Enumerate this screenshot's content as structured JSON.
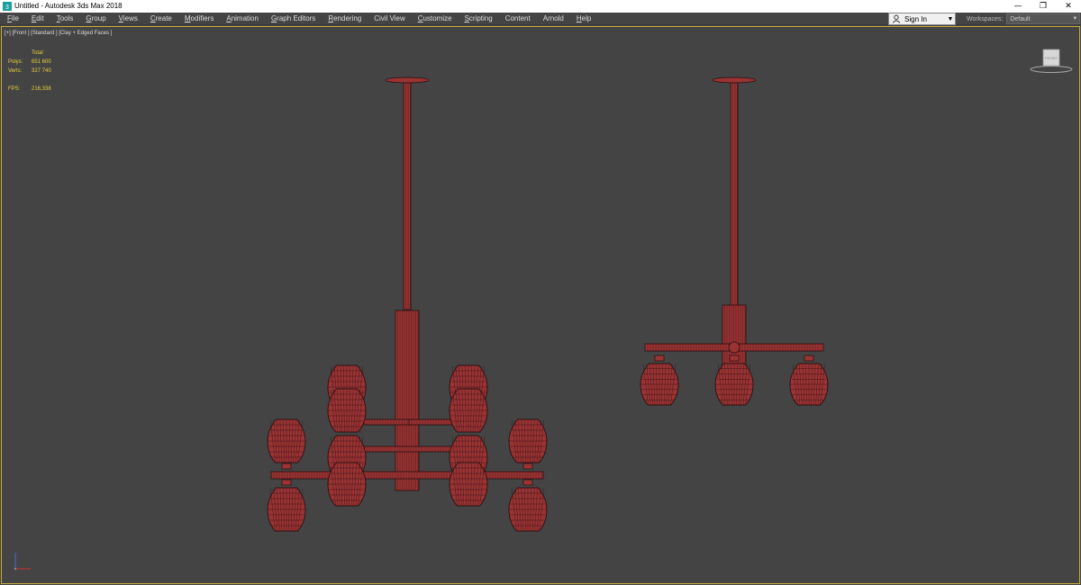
{
  "window": {
    "title": "Untitled - Autodesk 3ds Max 2018",
    "minimize": "—",
    "restore": "❐",
    "close": "✕",
    "app_icon": "3dsmax-icon"
  },
  "menu": [
    {
      "label": "File",
      "accel": "F",
      "rest": "ile"
    },
    {
      "label": "Edit",
      "accel": "E",
      "rest": "dit"
    },
    {
      "label": "Tools",
      "accel": "T",
      "rest": "ools"
    },
    {
      "label": "Group",
      "accel": "G",
      "rest": "roup"
    },
    {
      "label": "Views",
      "accel": "V",
      "rest": "iews"
    },
    {
      "label": "Create",
      "accel": "C",
      "rest": "reate"
    },
    {
      "label": "Modifiers",
      "accel": "M",
      "rest": "odifiers"
    },
    {
      "label": "Animation",
      "accel": "A",
      "rest": "nimation"
    },
    {
      "label": "Graph Editors",
      "accel": "G",
      "rest": "raph Editors"
    },
    {
      "label": "Rendering",
      "accel": "R",
      "rest": "endering"
    },
    {
      "label": "Civil View",
      "accel": "",
      "rest": "Civil View"
    },
    {
      "label": "Customize",
      "accel": "C",
      "rest": "ustomize"
    },
    {
      "label": "Scripting",
      "accel": "S",
      "rest": "cripting"
    },
    {
      "label": "Content",
      "accel": "",
      "rest": "Content"
    },
    {
      "label": "Arnold",
      "accel": "",
      "rest": "Arnold"
    },
    {
      "label": "Help",
      "accel": "H",
      "rest": "elp"
    }
  ],
  "signin": {
    "label": "Sign In",
    "icon": "user-icon",
    "caret": "▼"
  },
  "workspaces": {
    "label": "Workspaces:",
    "value": "Default",
    "caret": "▼"
  },
  "viewport": {
    "label": "[+] [Front ] [Standard ] [Clay + Edged Faces ]",
    "stats": {
      "header": "Total",
      "polys_label": "Polys:",
      "polys": "651 600",
      "verts_label": "Verts:",
      "verts": "327 740",
      "fps_label": "FPS:",
      "fps": "216,338"
    },
    "viewcube_label": "FRONT",
    "colors": {
      "model": "#9a3334",
      "wire": "#2a0e0e",
      "stats": "#e6d23a",
      "border": "#c9a93a",
      "background": "#444444"
    }
  }
}
